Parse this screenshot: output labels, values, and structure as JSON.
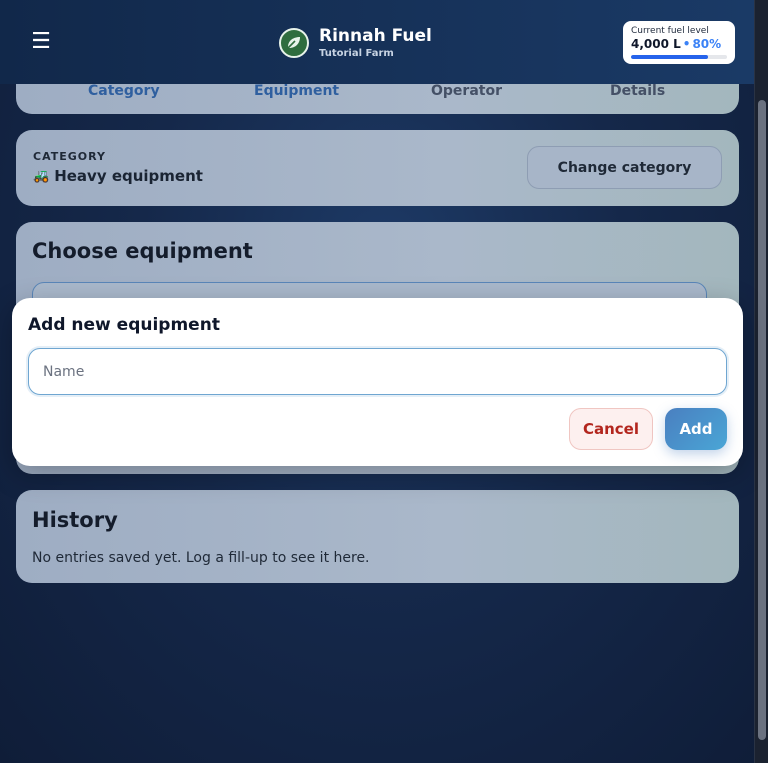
{
  "header": {
    "menu_icon": "hamburger-icon",
    "brand_logo_icon": "leaf-logo-icon",
    "title": "Rinnah Fuel",
    "subtitle": "Tutorial Farm",
    "fuel": {
      "label": "Current fuel level",
      "liters": "4,000 L",
      "separator": "•",
      "percent": "80%",
      "level_fraction": 0.8
    }
  },
  "steps": {
    "items": [
      {
        "label": "Category"
      },
      {
        "label": "Equipment"
      },
      {
        "label": "Operator"
      },
      {
        "label": "Details"
      }
    ]
  },
  "category": {
    "caption": "CATEGORY",
    "icon": "tractor-icon",
    "value": "Heavy equipment",
    "change_label": "Change category"
  },
  "choose": {
    "title": "Choose equipment"
  },
  "history": {
    "title": "History",
    "empty_text": "No entries saved yet. Log a fill-up to see it here."
  },
  "modal": {
    "title": "Add new equipment",
    "name_placeholder": "Name",
    "name_value": "",
    "cancel_label": "Cancel",
    "add_label": "Add"
  },
  "colors": {
    "header_bg": "#163158",
    "accent": "#3b82f6",
    "cancel_text": "#b3261e",
    "add_bg": "#4a8fcb"
  }
}
